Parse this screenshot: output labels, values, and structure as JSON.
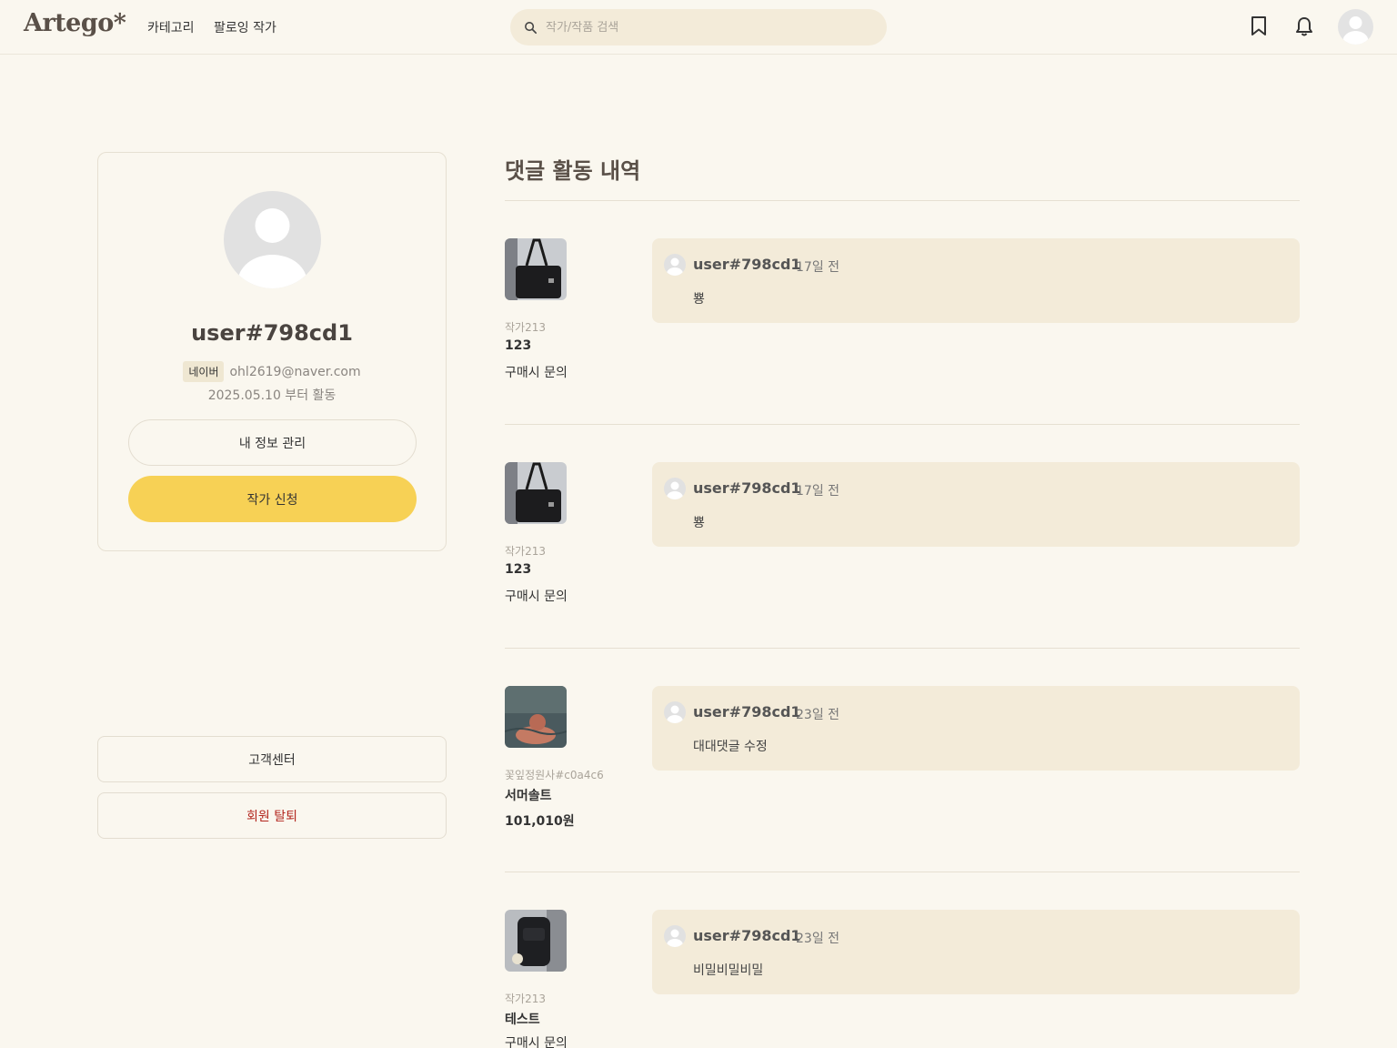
{
  "header": {
    "logo": "Artego*",
    "nav": [
      {
        "label": "카테고리"
      },
      {
        "label": "팔로잉 작가"
      }
    ],
    "search_placeholder": "작가/작품 검색",
    "icons": [
      "search-icon",
      "bookmark-icon",
      "bell-icon",
      "avatar"
    ]
  },
  "profile": {
    "username": "user#798cd1",
    "provider": "네이버",
    "email": "ohl2619@naver.com",
    "since": "2025.05.10 부터 활동",
    "manage_label": "내 정보 관리",
    "apply_label": "작가 신청"
  },
  "side_buttons": {
    "support_label": "고객센터",
    "withdraw_label": "회원 탈퇴"
  },
  "main": {
    "title": "댓글 활동 내역",
    "entries": [
      {
        "thumb": "black-bag",
        "artist": "작가213",
        "title": "123",
        "sub": "구매시 문의",
        "comment": {
          "user": "user#798cd1",
          "time": "17일 전",
          "text": "뿅"
        }
      },
      {
        "thumb": "black-bag",
        "artist": "작가213",
        "title": "123",
        "sub": "구매시 문의",
        "comment": {
          "user": "user#798cd1",
          "time": "17일 전",
          "text": "뿅"
        }
      },
      {
        "thumb": "swimmer-photo",
        "artist": "꽃잎정원사#c0a4c6",
        "title": "서머솔트",
        "sub": "101,010원",
        "comment": {
          "user": "user#798cd1",
          "time": "23일 전",
          "text": "대대댓글 수정"
        }
      },
      {
        "thumb": "backpack",
        "artist": "작가213",
        "title": "테스트",
        "sub": "구매시 문의",
        "comment": {
          "user": "user#798cd1",
          "time": "23일 전",
          "text": "비밀비밀비밀"
        }
      }
    ]
  },
  "colors": {
    "background": "#faf7ef",
    "comment_bg": "#f3ebd9",
    "accent_yellow": "#f7d155",
    "danger_text": "#c0392b",
    "title_brown": "#5a5048"
  }
}
